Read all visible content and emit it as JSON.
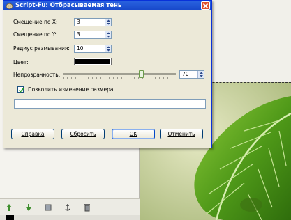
{
  "dialog": {
    "title": "Script-Fu: Отбрасываемая тень",
    "fields": {
      "offset_x": {
        "label": "Смещение по X:",
        "value": "3"
      },
      "offset_y": {
        "label": "Смещение по Y:",
        "value": "3"
      },
      "blur_radius": {
        "label": "Радиус размывания:",
        "value": "10"
      },
      "color": {
        "label": "Цвет:",
        "value": "#000000"
      },
      "opacity": {
        "label": "Непрозрачность:",
        "value": "70",
        "fraction": 0.7
      }
    },
    "allow_resize": {
      "label": "Позволить изменение размера",
      "checked": true
    },
    "buttons": {
      "help": "Справка",
      "reset": "Сбросить",
      "ok": "OK",
      "cancel": "Отменить"
    }
  },
  "icons": {
    "title": "gimp-logo-icon",
    "close": "close-icon",
    "spin": "spin-arrows-icon",
    "check": "checkmark-icon",
    "toolbar": [
      "arrow-icon",
      "anchor-icon",
      "layer-icon",
      "anchor-icon",
      "trash-icon"
    ]
  },
  "colors": {
    "title_bar": "#1747c9",
    "dialog_bg": "#ece9d8",
    "swatch": "#000000",
    "leaf_green": "#5a9a1a"
  }
}
